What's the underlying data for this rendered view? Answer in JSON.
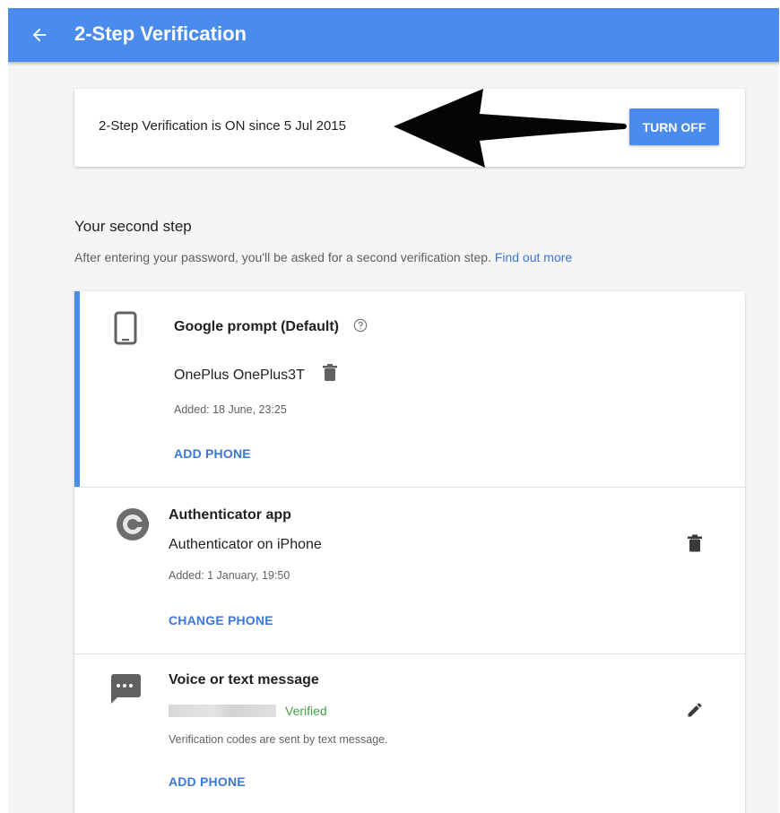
{
  "appbar": {
    "title": "2-Step Verification",
    "back_icon": "arrow-back-icon"
  },
  "status": {
    "text": "2-Step Verification is ON since 5 Jul 2015",
    "turn_off_label": "TURN OFF"
  },
  "second_step": {
    "title": "Your second step",
    "description": "After entering your password, you'll be asked for a second verification step.",
    "find_out_more": "Find out more"
  },
  "methods": [
    {
      "title": "Google prompt (Default)",
      "device": "OnePlus OnePlus3T",
      "added": "Added: 18 June, 23:25",
      "action": "ADD PHONE",
      "icon": "phone-icon"
    },
    {
      "title": "Authenticator app",
      "device": "Authenticator on iPhone",
      "added": "Added: 1 January, 19:50",
      "action": "CHANGE PHONE",
      "icon": "authenticator-icon"
    },
    {
      "title": "Voice or text message",
      "status": "Verified",
      "note": "Verification codes are sent by text message.",
      "action": "ADD PHONE",
      "icon": "message-icon"
    }
  ],
  "colors": {
    "primary": "#4a8ced",
    "link": "#3b78d8",
    "verified": "#43a047"
  }
}
